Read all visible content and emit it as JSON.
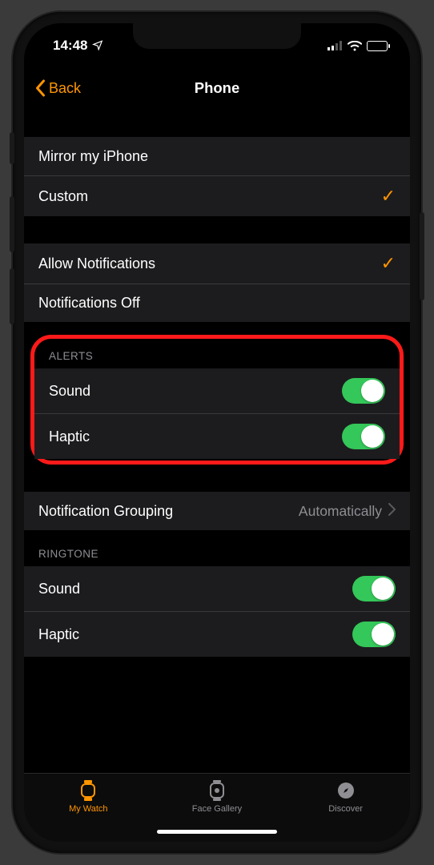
{
  "status": {
    "time": "14:48"
  },
  "nav": {
    "back": "Back",
    "title": "Phone"
  },
  "group1": {
    "items": [
      {
        "label": "Mirror my iPhone",
        "selected": false
      },
      {
        "label": "Custom",
        "selected": true
      }
    ]
  },
  "group2": {
    "items": [
      {
        "label": "Allow Notifications",
        "selected": true
      },
      {
        "label": "Notifications Off",
        "selected": false
      }
    ]
  },
  "alerts": {
    "header": "Alerts",
    "sound": {
      "label": "Sound",
      "on": true
    },
    "haptic": {
      "label": "Haptic",
      "on": true
    }
  },
  "grouping": {
    "label": "Notification Grouping",
    "value": "Automatically"
  },
  "ringtone": {
    "header": "Ringtone",
    "sound": {
      "label": "Sound",
      "on": true
    },
    "haptic": {
      "label": "Haptic",
      "on": true
    }
  },
  "tabs": {
    "watch": "My Watch",
    "gallery": "Face Gallery",
    "discover": "Discover"
  }
}
